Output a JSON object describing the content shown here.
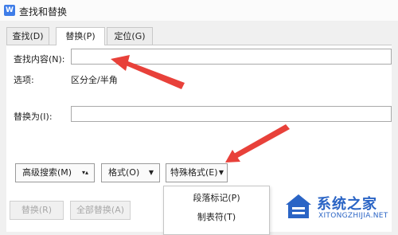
{
  "window": {
    "app_icon": "W",
    "title": "查找和替换"
  },
  "tabs": [
    {
      "label": "查找(D)"
    },
    {
      "label": "替换(P)"
    },
    {
      "label": "定位(G)"
    }
  ],
  "find": {
    "label": "查找内容(N):",
    "value": ""
  },
  "options": {
    "label": "选项:",
    "value": "区分全/半角"
  },
  "replace": {
    "label": "替换为(I):",
    "value": ""
  },
  "buttons": {
    "advanced_search": "高级搜索(M)",
    "format": "格式(O)",
    "special_format": "特殊格式(E)",
    "replace": "替换(R)",
    "replace_all": "全部替换(A)"
  },
  "special_menu": {
    "items": [
      "段落标记(P)",
      "制表符(T)"
    ]
  },
  "watermark": {
    "name": "系统之家",
    "url": "XITONGZHIJIA.NET"
  },
  "colors": {
    "arrow": "#e8413a",
    "accent": "#3f7de8",
    "watermark": "#2a64c5"
  }
}
